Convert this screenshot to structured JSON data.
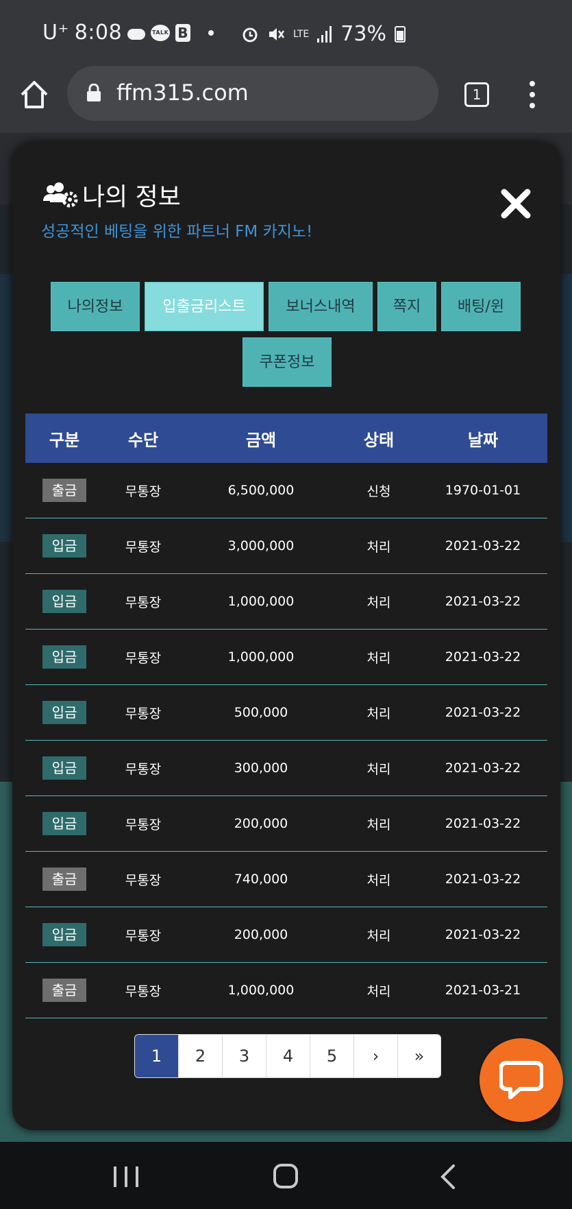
{
  "status_bar": {
    "carrier": "U⁺",
    "time": "8:08",
    "bicon_letter": "B",
    "talk_label": "TALK",
    "network": "LTE",
    "battery": "73%"
  },
  "browser": {
    "url": "ffm315.com",
    "tab_count": "1"
  },
  "modal": {
    "title": "나의 정보",
    "subtitle": "성공적인 베팅을 위한 파트너 FM 카지노!",
    "tabs": [
      {
        "label": "나의정보",
        "active": false
      },
      {
        "label": "입출금리스트",
        "active": true
      },
      {
        "label": "보너스내역",
        "active": false
      },
      {
        "label": "쪽지",
        "active": false
      },
      {
        "label": "배팅/윈",
        "active": false
      },
      {
        "label": "쿠폰정보",
        "active": false
      }
    ],
    "table": {
      "headers": [
        "구분",
        "수단",
        "금액",
        "상태",
        "날짜"
      ],
      "rows": [
        {
          "type": "출금",
          "method": "무통장",
          "amount": "6,500,000",
          "status": "신청",
          "date": "1970-01-01"
        },
        {
          "type": "입금",
          "method": "무통장",
          "amount": "3,000,000",
          "status": "처리",
          "date": "2021-03-22"
        },
        {
          "type": "입금",
          "method": "무통장",
          "amount": "1,000,000",
          "status": "처리",
          "date": "2021-03-22"
        },
        {
          "type": "입금",
          "method": "무통장",
          "amount": "1,000,000",
          "status": "처리",
          "date": "2021-03-22"
        },
        {
          "type": "입금",
          "method": "무통장",
          "amount": "500,000",
          "status": "처리",
          "date": "2021-03-22"
        },
        {
          "type": "입금",
          "method": "무통장",
          "amount": "300,000",
          "status": "처리",
          "date": "2021-03-22"
        },
        {
          "type": "입금",
          "method": "무통장",
          "amount": "200,000",
          "status": "처리",
          "date": "2021-03-22"
        },
        {
          "type": "출금",
          "method": "무통장",
          "amount": "740,000",
          "status": "처리",
          "date": "2021-03-22"
        },
        {
          "type": "입금",
          "method": "무통장",
          "amount": "200,000",
          "status": "처리",
          "date": "2021-03-22"
        },
        {
          "type": "출금",
          "method": "무통장",
          "amount": "1,000,000",
          "status": "처리",
          "date": "2021-03-21"
        }
      ]
    },
    "pagination": {
      "pages": [
        "1",
        "2",
        "3",
        "4",
        "5"
      ],
      "current": "1",
      "next": "›",
      "last": "»"
    }
  },
  "colors": {
    "accent_blue": "#2f4b93",
    "tab_teal": "#4fb3b3",
    "tab_active": "#86dcdc",
    "subtitle_blue": "#3f94d6",
    "chat_orange": "#f26f21",
    "withdraw_badge": "#6e6e6e",
    "deposit_badge": "#2f6b6b"
  },
  "icons": {
    "title_icon": "users-gear-icon",
    "close": "close-icon",
    "chat": "chat-bubble-icon"
  }
}
